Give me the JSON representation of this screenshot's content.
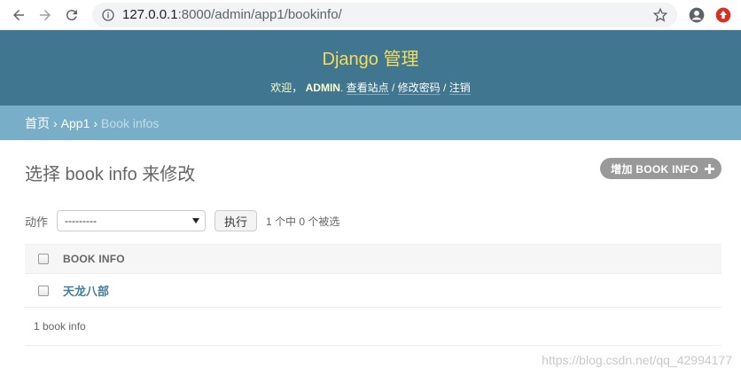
{
  "browser": {
    "url_host": "127.0.0.1",
    "url_rest": ":8000/admin/app1/bookinfo/"
  },
  "header": {
    "branding": "Django 管理",
    "welcome": "欢迎，",
    "username": "ADMIN",
    "dot": ".",
    "view_site": "查看站点",
    "change_password": "修改密码",
    "logout": "注销",
    "slash": "/"
  },
  "breadcrumbs": {
    "home": "首页",
    "app": "App1",
    "current": "Book infos",
    "sep": "›"
  },
  "content": {
    "title": "选择 book info 来修改",
    "add_button": "增加 BOOK INFO",
    "actions_label": "动作",
    "action_selected": "---------",
    "go_button": "执行",
    "counter": "1 个中 0 个被选",
    "column_header": "BOOK INFO",
    "rows": [
      {
        "title": "天龙八部"
      }
    ],
    "paginator": "1 book info"
  },
  "watermark": "https://blog.csdn.net/qq_42994177",
  "colors": {
    "header_bg": "#417690",
    "branding": "#f5dd5d",
    "breadcrumbs_bg": "#79aec8",
    "link": "#447e9b"
  }
}
